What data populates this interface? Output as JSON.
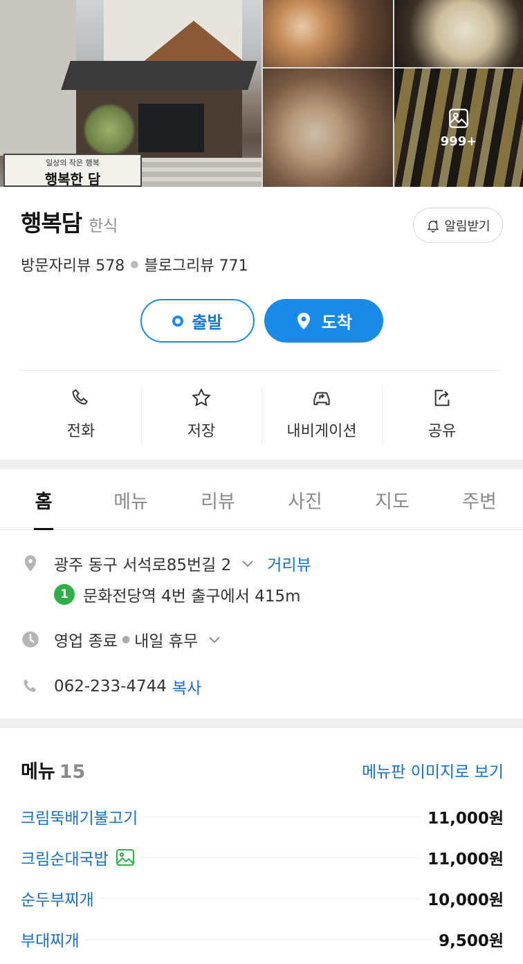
{
  "photos": {
    "more_count": "999+"
  },
  "place": {
    "name": "행복담",
    "category": "한식",
    "alarm_label": "알림받기",
    "visitor_reviews": "방문자리뷰 578",
    "blog_reviews": "블로그리뷰 771",
    "sign_text_top": "일상의 작은 행복",
    "sign_text_main": "행복한 담"
  },
  "route": {
    "depart_label": "출발",
    "arrive_label": "도착"
  },
  "actions": [
    {
      "label": "전화",
      "icon": "phone-icon"
    },
    {
      "label": "저장",
      "icon": "star-icon"
    },
    {
      "label": "내비게이션",
      "icon": "car-navigation-icon"
    },
    {
      "label": "공유",
      "icon": "share-icon"
    }
  ],
  "tabs": [
    {
      "label": "홈",
      "active": true
    },
    {
      "label": "메뉴"
    },
    {
      "label": "리뷰"
    },
    {
      "label": "사진"
    },
    {
      "label": "지도"
    },
    {
      "label": "주변"
    }
  ],
  "info": {
    "address": "광주 동구 서석로85번길 2",
    "street_view": "거리뷰",
    "subway_line": "1",
    "subway_text": "문화전당역 4번 출구에서 415m",
    "hours_status": "영업 종료",
    "hours_next": "내일 휴무",
    "phone": "062-233-4744",
    "copy": "복사"
  },
  "menu": {
    "title": "메뉴",
    "count": "15",
    "image_link": "메뉴판 이미지로 보기",
    "items": [
      {
        "name": "크림뚝배기불고기",
        "price": "11,000원"
      },
      {
        "name": "크림순대국밥",
        "price": "11,000원",
        "has_photo": true
      },
      {
        "name": "순두부찌개",
        "price": "10,000원"
      },
      {
        "name": "부대찌개",
        "price": "9,500원"
      }
    ]
  },
  "colors": {
    "accent": "#1a8ae8",
    "link": "#1b6fc4",
    "subway_line1": "#2fae4b"
  }
}
